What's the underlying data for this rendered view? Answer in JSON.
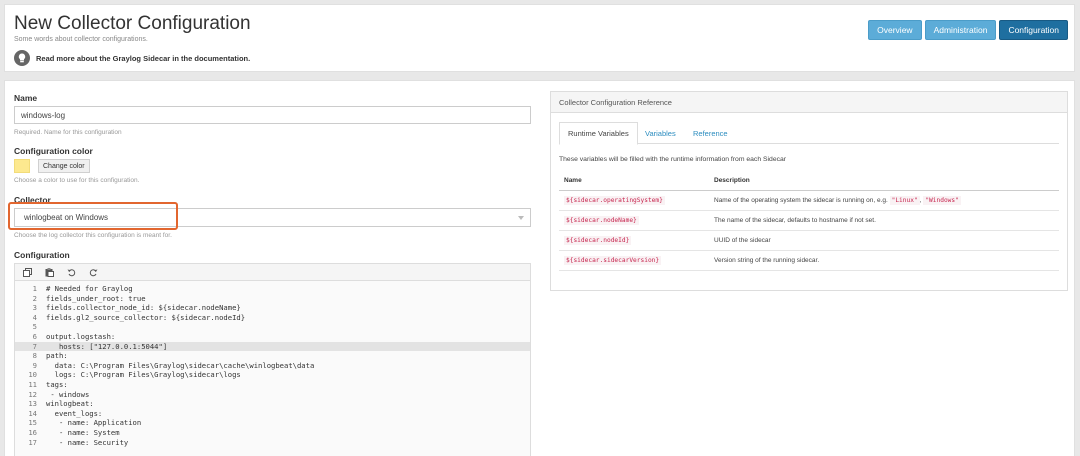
{
  "header": {
    "title": "New Collector Configuration",
    "subtitle": "Some words about collector configurations.",
    "doc_link": "Read more about the Graylog Sidecar in the documentation.",
    "nav": [
      {
        "label": "Overview",
        "active": false
      },
      {
        "label": "Administration",
        "active": false
      },
      {
        "label": "Configuration",
        "active": true
      }
    ]
  },
  "form": {
    "name_label": "Name",
    "name_value": "windows-log",
    "name_help": "Required. Name for this configuration",
    "color_label": "Configuration color",
    "color_value": "#fde98f",
    "change_color": "Change color",
    "color_help": "Choose a color to use for this configuration.",
    "collector_label": "Collector",
    "collector_value": "winlogbeat on Windows",
    "collector_help": "Choose the log collector this configuration is meant for.",
    "configuration_label": "Configuration"
  },
  "editor": {
    "toolbar": [
      "copy-icon",
      "paste-icon",
      "undo-icon",
      "redo-icon"
    ],
    "highlighted_line": 7,
    "lines": [
      "# Needed for Graylog",
      "fields_under_root: true",
      "fields.collector_node_id: ${sidecar.nodeName}",
      "fields.gl2_source_collector: ${sidecar.nodeId}",
      "",
      "output.logstash:",
      "   hosts: [\"127.0.0.1:5044\"]",
      "path:",
      "  data: C:\\Program Files\\Graylog\\sidecar\\cache\\winlogbeat\\data",
      "  logs: C:\\Program Files\\Graylog\\sidecar\\logs",
      "tags:",
      " - windows",
      "winlogbeat:",
      "  event_logs:",
      "   - name: Application",
      "   - name: System",
      "   - name: Security"
    ]
  },
  "reference": {
    "panel_title": "Collector Configuration Reference",
    "tabs": [
      {
        "label": "Runtime Variables",
        "active": true
      },
      {
        "label": "Variables",
        "active": false
      },
      {
        "label": "Reference",
        "active": false
      }
    ],
    "info": "These variables will be filled with the runtime information from each Sidecar",
    "columns": [
      "Name",
      "Description"
    ],
    "rows": [
      {
        "name": "${sidecar.operatingSystem}",
        "desc_pre": "Name of the operating system the sidecar is running on, e.g. ",
        "code1": "\"Linux\"",
        "sep": ", ",
        "code2": "\"Windows\""
      },
      {
        "name": "${sidecar.nodeName}",
        "desc_pre": "The name of the sidecar, defaults to hostname if not set."
      },
      {
        "name": "${sidecar.nodeId}",
        "desc_pre": "UUID of the sidecar"
      },
      {
        "name": "${sidecar.sidecarVersion}",
        "desc_pre": "Version string of the running sidecar."
      }
    ]
  }
}
